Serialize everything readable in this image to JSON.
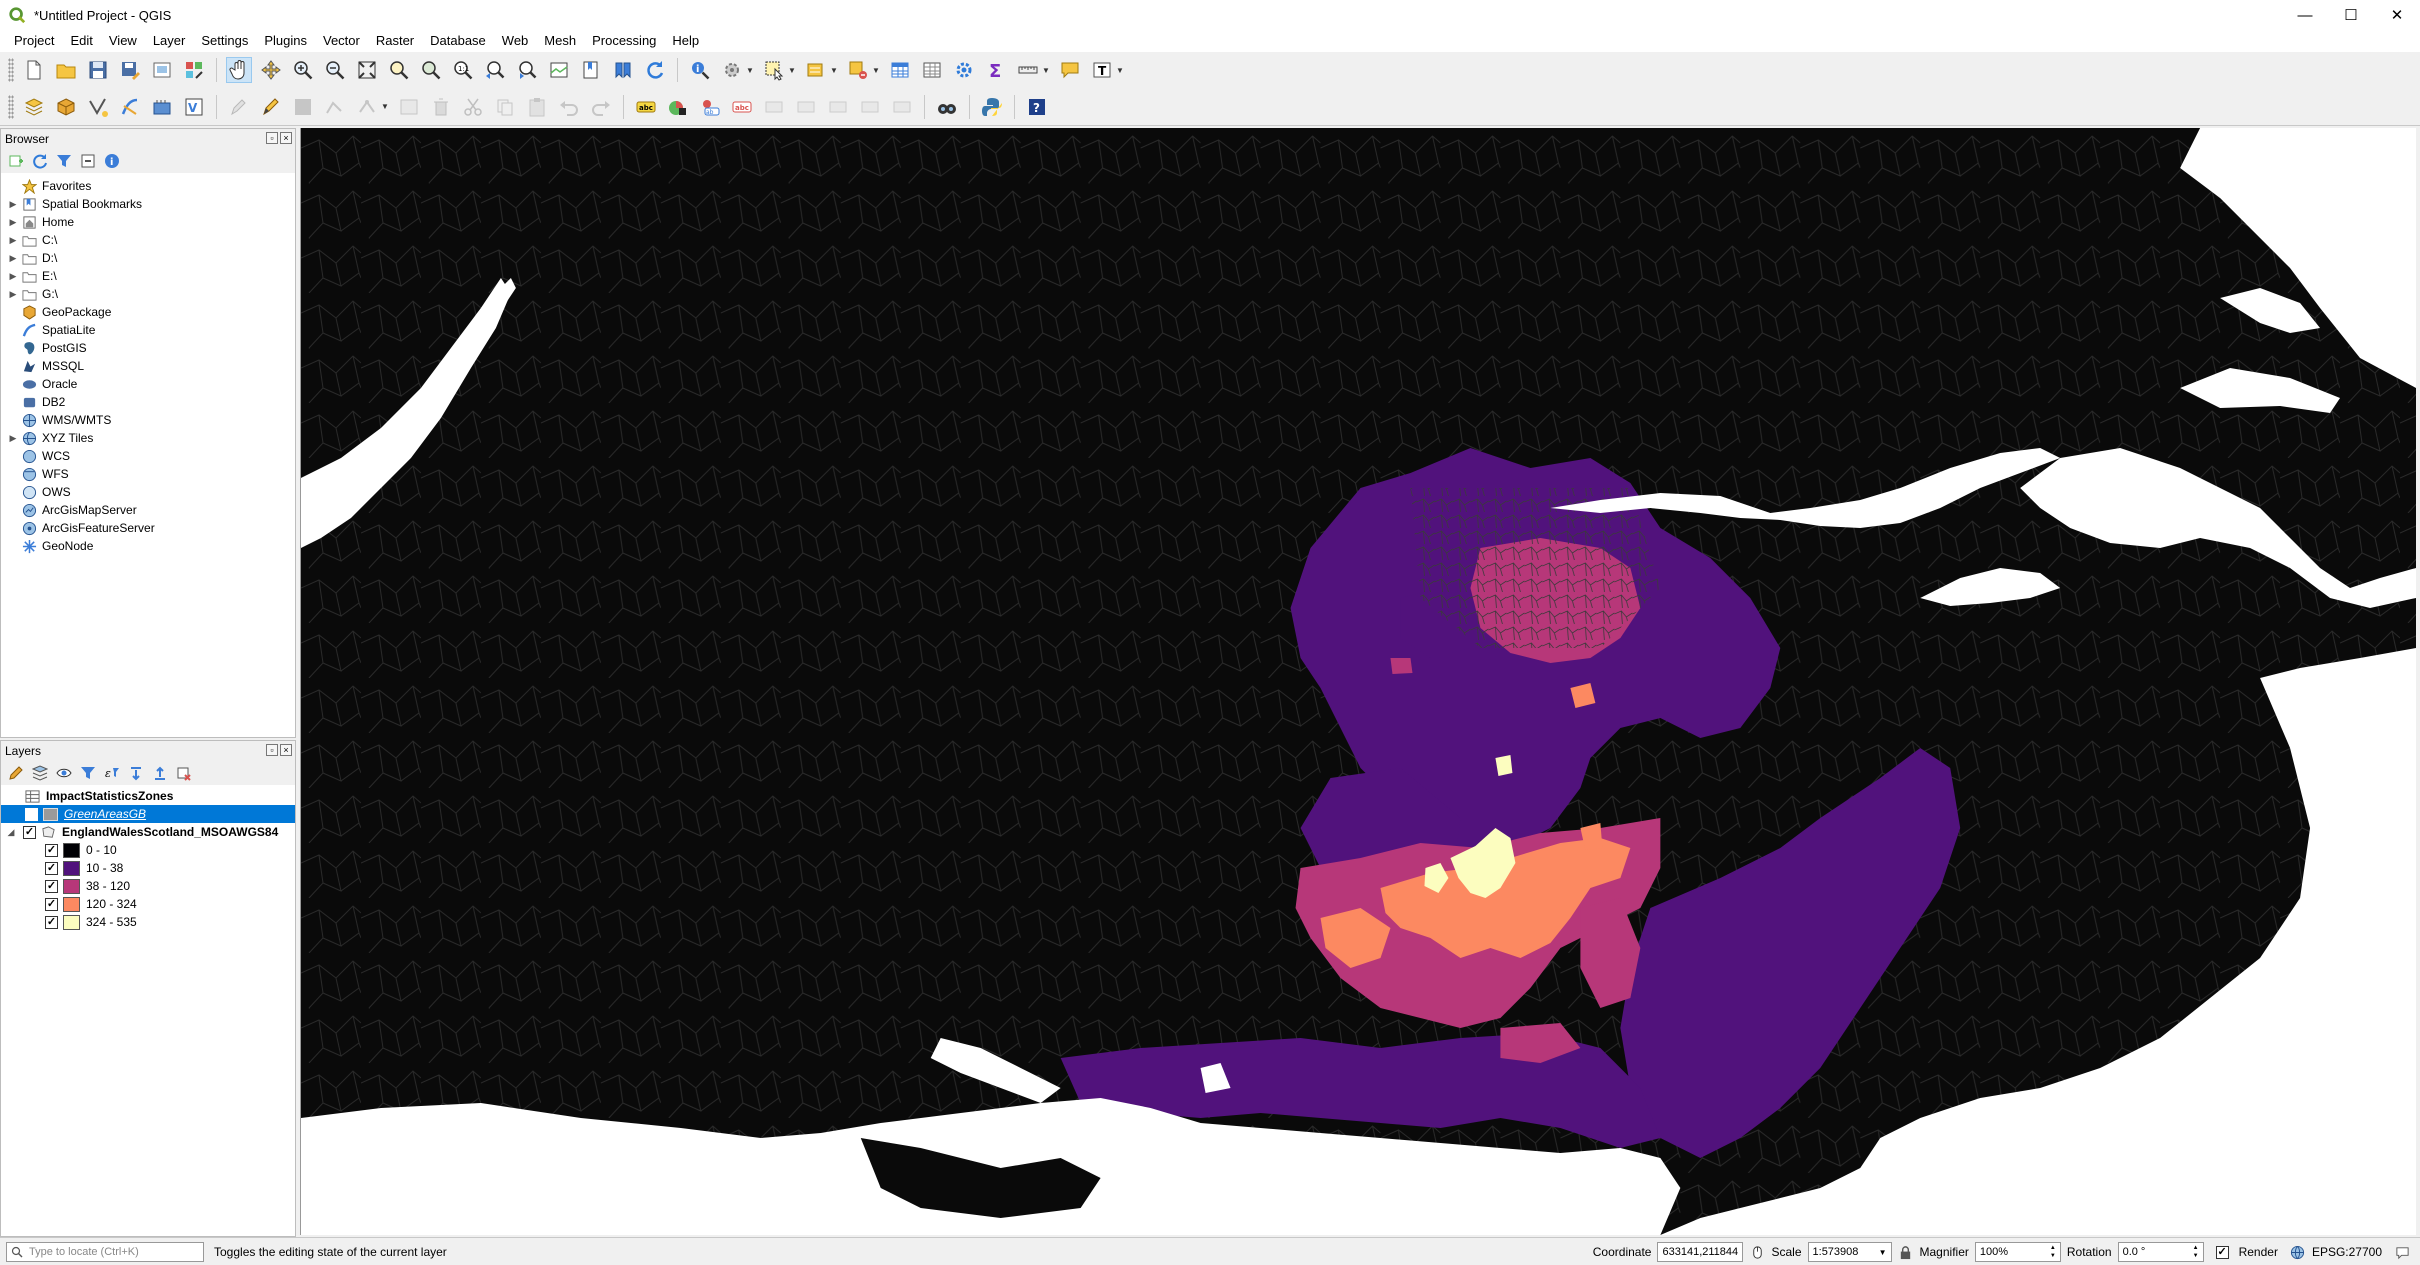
{
  "window": {
    "title": "*Untitled Project - QGIS",
    "minimize": "—",
    "maximize": "☐",
    "close": "✕"
  },
  "menus": [
    "Project",
    "Edit",
    "View",
    "Layer",
    "Settings",
    "Plugins",
    "Vector",
    "Raster",
    "Database",
    "Web",
    "Mesh",
    "Processing",
    "Help"
  ],
  "browser": {
    "title": "Browser",
    "items": [
      {
        "label": "Favorites",
        "icon": "star-icon",
        "expandable": false
      },
      {
        "label": "Spatial Bookmarks",
        "icon": "bookmark-icon",
        "expandable": true
      },
      {
        "label": "Home",
        "icon": "home-folder-icon",
        "expandable": true
      },
      {
        "label": "C:\\",
        "icon": "drive-icon",
        "expandable": true
      },
      {
        "label": "D:\\",
        "icon": "drive-icon",
        "expandable": true
      },
      {
        "label": "E:\\",
        "icon": "drive-icon",
        "expandable": true
      },
      {
        "label": "G:\\",
        "icon": "drive-icon",
        "expandable": true
      },
      {
        "label": "GeoPackage",
        "icon": "geopackage-icon",
        "expandable": false
      },
      {
        "label": "SpatiaLite",
        "icon": "spatialite-icon",
        "expandable": false
      },
      {
        "label": "PostGIS",
        "icon": "postgis-icon",
        "expandable": false
      },
      {
        "label": "MSSQL",
        "icon": "mssql-icon",
        "expandable": false
      },
      {
        "label": "Oracle",
        "icon": "oracle-icon",
        "expandable": false
      },
      {
        "label": "DB2",
        "icon": "db2-icon",
        "expandable": false
      },
      {
        "label": "WMS/WMTS",
        "icon": "wms-icon",
        "expandable": false
      },
      {
        "label": "XYZ Tiles",
        "icon": "xyz-icon",
        "expandable": true
      },
      {
        "label": "WCS",
        "icon": "wcs-icon",
        "expandable": false
      },
      {
        "label": "WFS",
        "icon": "wfs-icon",
        "expandable": false
      },
      {
        "label": "OWS",
        "icon": "ows-icon",
        "expandable": false
      },
      {
        "label": "ArcGisMapServer",
        "icon": "arcgis-map-icon",
        "expandable": false
      },
      {
        "label": "ArcGisFeatureServer",
        "icon": "arcgis-feature-icon",
        "expandable": false
      },
      {
        "label": "GeoNode",
        "icon": "geonode-icon",
        "expandable": false
      }
    ]
  },
  "layers": {
    "title": "Layers",
    "items": [
      {
        "label": "ImpactStatisticsZones",
        "type": "table"
      },
      {
        "label": "GreenAreasGB",
        "type": "polygon"
      },
      {
        "label": "EnglandWalesScotland_MSOAWGS84",
        "type": "polygon"
      }
    ],
    "legend": [
      {
        "label": "0 - 10",
        "color": "#000004"
      },
      {
        "label": "10 - 38",
        "color": "#51127c"
      },
      {
        "label": "38 - 120",
        "color": "#b73779"
      },
      {
        "label": "120 - 324",
        "color": "#fc8961"
      },
      {
        "label": "324 - 535",
        "color": "#fcfdbf"
      }
    ]
  },
  "statusbar": {
    "locate_placeholder": "Type to locate (Ctrl+K)",
    "message": "Toggles the editing state of the current layer",
    "coordinate_label": "Coordinate",
    "coordinate_value": "633141,211844",
    "scale_label": "Scale",
    "scale_value": "1:573908",
    "magnifier_label": "Magnifier",
    "magnifier_value": "100%",
    "rotation_label": "Rotation",
    "rotation_value": "0.0 °",
    "render_label": "Render",
    "crs": "EPSG:27700"
  },
  "colors": {
    "map_background": "#0a0a0a",
    "water": "#ffffff",
    "selection": "#0078d7"
  }
}
